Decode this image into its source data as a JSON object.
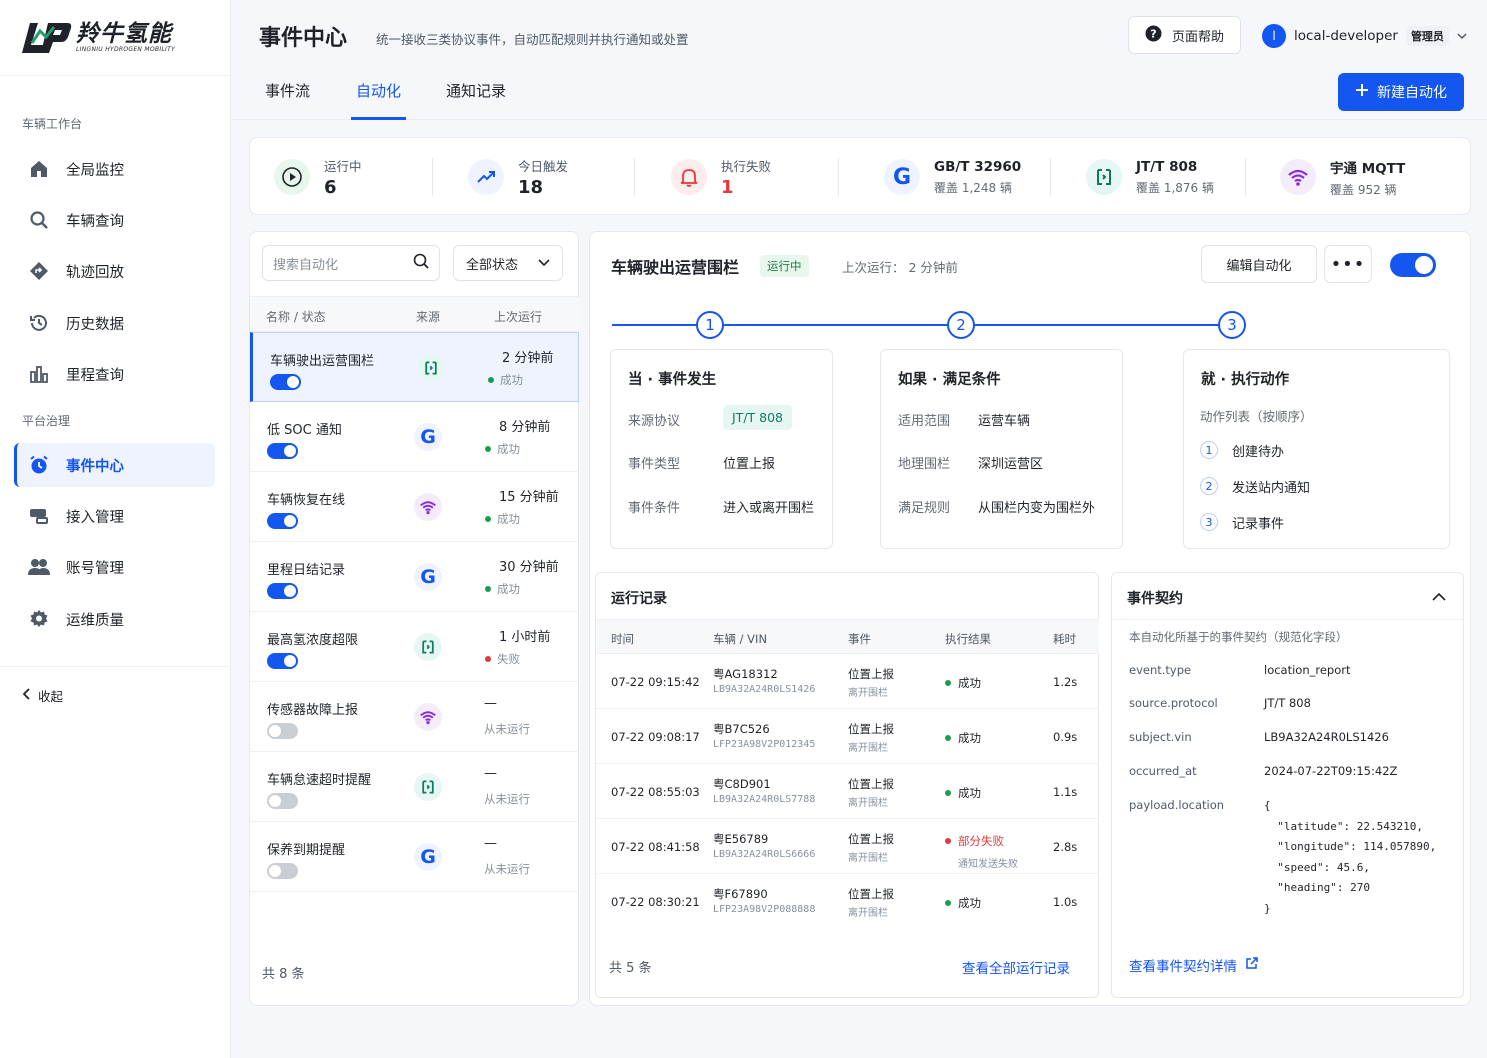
{
  "brand": {
    "name_cn": "羚牛氢能",
    "name_en": "LINGNIU HYDROGEN MOBILITY",
    "accent": "#1456f0"
  },
  "sidebar": {
    "groups": [
      "车辆工作台",
      "平台治理"
    ],
    "items": [
      {
        "label": "全局监控",
        "icon": "home-icon"
      },
      {
        "label": "车辆查询",
        "icon": "search-icon"
      },
      {
        "label": "轨迹回放",
        "icon": "route-icon"
      },
      {
        "label": "历史数据",
        "icon": "history-icon"
      },
      {
        "label": "里程查询",
        "icon": "bar-chart-icon"
      },
      {
        "label": "事件中心",
        "icon": "alarm-clock-icon",
        "active": true
      },
      {
        "label": "接入管理",
        "icon": "connect-icon"
      },
      {
        "label": "账号管理",
        "icon": "users-icon"
      },
      {
        "label": "运维质量",
        "icon": "gear-icon"
      }
    ],
    "collapse_label": "收起"
  },
  "header": {
    "title": "事件中心",
    "subtitle": "统一接收三类协议事件，自动匹配规则并执行通知或处置",
    "help_label": "页面帮助",
    "user": {
      "initial": "l",
      "name": "local-developer",
      "role": "管理员"
    }
  },
  "tabs": [
    "事件流",
    "自动化",
    "通知记录"
  ],
  "new_button": "新建自动化",
  "stats": {
    "running": {
      "label": "运行中",
      "value": "6"
    },
    "triggered": {
      "label": "今日触发",
      "value": "18"
    },
    "failed": {
      "label": "执行失败",
      "value": "1"
    },
    "protocols": [
      {
        "name": "GB/T 32960",
        "sub": "覆盖 1,248 辆"
      },
      {
        "name": "JT/T 808",
        "sub": "覆盖 1,876 辆"
      },
      {
        "name": "宇通 MQTT",
        "sub": "覆盖 952 辆"
      }
    ]
  },
  "list": {
    "search_placeholder": "搜索自动化",
    "status_filter": "全部状态",
    "columns": [
      "名称 / 状态",
      "来源",
      "上次运行"
    ],
    "rows": [
      {
        "name": "车辆驶出运营围栏",
        "enabled": true,
        "source": "jt808",
        "time": "2 分钟前",
        "status": "成功",
        "status_color": "#1a9e4b"
      },
      {
        "name": "低 SOC 通知",
        "enabled": true,
        "source": "gbt",
        "time": "8 分钟前",
        "status": "成功",
        "status_color": "#1a9e4b"
      },
      {
        "name": "车辆恢复在线",
        "enabled": true,
        "source": "mqtt",
        "time": "15 分钟前",
        "status": "成功",
        "status_color": "#1a9e4b"
      },
      {
        "name": "里程日结记录",
        "enabled": true,
        "source": "gbt",
        "time": "30 分钟前",
        "status": "成功",
        "status_color": "#1a9e4b"
      },
      {
        "name": "最高氢浓度超限",
        "enabled": true,
        "source": "jt808",
        "time": "1 小时前",
        "status": "失败",
        "status_color": "#e5383b"
      },
      {
        "name": "传感器故障上报",
        "enabled": false,
        "source": "mqtt",
        "time": "—",
        "status": "从未运行",
        "status_color": ""
      },
      {
        "name": "车辆怠速超时提醒",
        "enabled": false,
        "source": "jt808",
        "time": "—",
        "status": "从未运行",
        "status_color": ""
      },
      {
        "name": "保养到期提醒",
        "enabled": false,
        "source": "gbt",
        "time": "—",
        "status": "从未运行",
        "status_color": ""
      }
    ],
    "footer": "共 8 条"
  },
  "detail": {
    "title": "车辆驶出运营围栏",
    "status_tag": "运行中",
    "last_run": "上次运行： 2 分钟前",
    "edit_label": "编辑自动化",
    "more_label": "•••",
    "steps": [
      "1",
      "2",
      "3"
    ],
    "when": {
      "title": "当 · 事件发生",
      "rows": [
        {
          "k": "来源协议",
          "v": "JT/T 808"
        },
        {
          "k": "事件类型",
          "v": "位置上报"
        },
        {
          "k": "事件条件",
          "v": "进入或离开围栏"
        }
      ]
    },
    "if": {
      "title": "如果 · 满足条件",
      "rows": [
        {
          "k": "适用范围",
          "v": "运营车辆"
        },
        {
          "k": "地理围栏",
          "v": "深圳运营区"
        },
        {
          "k": "满足规则",
          "v": "从围栏内变为围栏外"
        }
      ]
    },
    "then": {
      "title": "就 · 执行动作",
      "list_label": "动作列表（按顺序）",
      "actions": [
        "创建待办",
        "发送站内通知",
        "记录事件"
      ]
    }
  },
  "records": {
    "title": "运行记录",
    "columns": [
      "时间",
      "车辆 / VIN",
      "事件",
      "执行结果",
      "耗时"
    ],
    "rows": [
      {
        "time": "07-22 09:15:42",
        "plate": "粤AG18312",
        "vin": "LB9A32A24R0LS1426",
        "event": "位置上报",
        "event_sub": "离开围栏",
        "result": "成功",
        "result_sub": "",
        "color": "#1a9e4b",
        "dur": "1.2s"
      },
      {
        "time": "07-22 09:08:17",
        "plate": "粤B7C526",
        "vin": "LFP23A98V2P012345",
        "event": "位置上报",
        "event_sub": "离开围栏",
        "result": "成功",
        "result_sub": "",
        "color": "#1a9e4b",
        "dur": "0.9s"
      },
      {
        "time": "07-22 08:55:03",
        "plate": "粤C8D901",
        "vin": "LB9A32A24R0LS7788",
        "event": "位置上报",
        "event_sub": "离开围栏",
        "result": "成功",
        "result_sub": "",
        "color": "#1a9e4b",
        "dur": "1.1s"
      },
      {
        "time": "07-22 08:41:58",
        "plate": "粤E56789",
        "vin": "LB9A32A24R0LS6666",
        "event": "位置上报",
        "event_sub": "离开围栏",
        "result": "部分失败",
        "result_sub": "通知发送失败",
        "color": "#e5383b",
        "dur": "2.8s"
      },
      {
        "time": "07-22 08:30:21",
        "plate": "粤F67890",
        "vin": "LFP23A98V2P088888",
        "event": "位置上报",
        "event_sub": "离开围栏",
        "result": "成功",
        "result_sub": "",
        "color": "#1a9e4b",
        "dur": "1.0s"
      }
    ],
    "footer": "共 5 条",
    "link": "查看全部运行记录"
  },
  "contract": {
    "title": "事件契约",
    "desc": "本自动化所基于的事件契约（规范化字段）",
    "fields": [
      {
        "k": "event.type",
        "v": "location_report"
      },
      {
        "k": "source.protocol",
        "v": "JT/T 808"
      },
      {
        "k": "subject.vin",
        "v": "LB9A32A24R0LS1426"
      },
      {
        "k": "occurred_at",
        "v": "2024-07-22T09:15:42Z"
      },
      {
        "k": "payload.location",
        "v": ""
      }
    ],
    "payload_json": "{\n  \"latitude\": 22.543210,\n  \"longitude\": 114.057890,\n  \"speed\": 45.6,\n  \"heading\": 270\n}",
    "link": "查看事件契约详情"
  }
}
